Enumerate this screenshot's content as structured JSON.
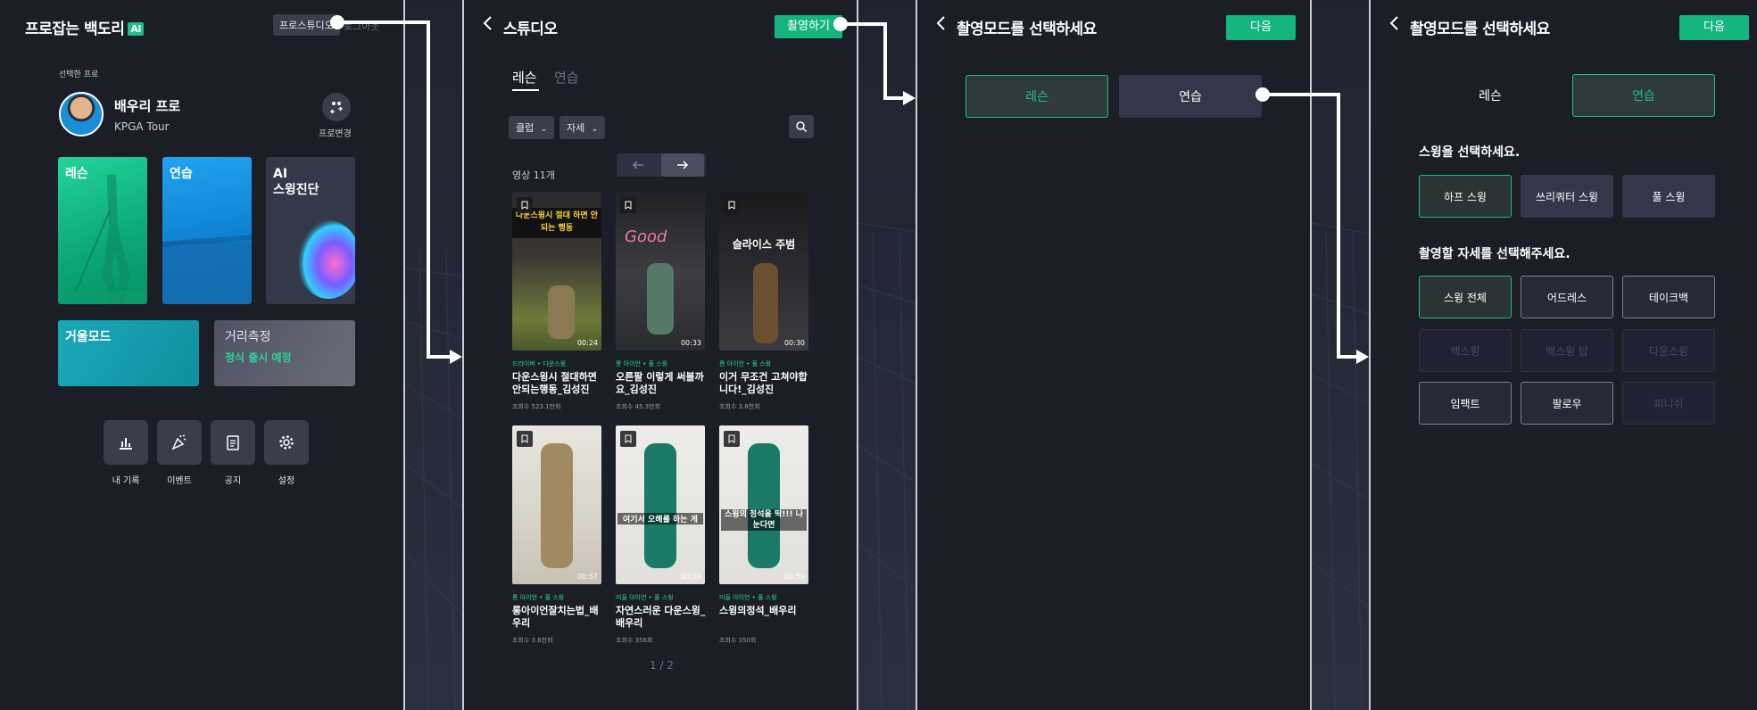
{
  "colors": {
    "accent": "#14b57f",
    "panel_bg": "#1b1d27",
    "button_bg": "#3a3d4a"
  },
  "screen1": {
    "brand": "프로잡는 백도리",
    "brand_badge": "AI",
    "pro_studio_button": "프로스튜디오",
    "logout": "로그아웃",
    "selected_label": "선택한 프로",
    "pro_name": "배우리 프로",
    "pro_tour": "KPGA Tour",
    "pro_change_label": "프로변경",
    "tiles": {
      "lesson": "레슨",
      "practice": "연습",
      "ai_swing": "AI\n스윙진단",
      "mirror": "거울모드",
      "distance": "거리측정",
      "distance_sub": "정식 출시 예정"
    },
    "menu": [
      {
        "label": "내 기록",
        "icon": "bar-chart-icon"
      },
      {
        "label": "이벤트",
        "icon": "party-popper-icon"
      },
      {
        "label": "공지",
        "icon": "clipboard-icon"
      },
      {
        "label": "설정",
        "icon": "gear-icon"
      }
    ]
  },
  "screen2": {
    "title": "스튜디오",
    "record_button": "촬영하기",
    "tabs": [
      "레슨",
      "연습"
    ],
    "filters": [
      "클럽",
      "자세"
    ],
    "count": "영상 11개",
    "videos": [
      {
        "tag": "드라이버 • 다운스윙",
        "title": "다운스윙시 절대하면 안되는행동_김성진",
        "views": "조회수 523.1만회",
        "duration": "00:24"
      },
      {
        "tag": "롱 아이언 • 풀 스윙",
        "title": "오른팔 이렇게 써볼까요_김성진",
        "views": "조회수 45.3만회",
        "duration": "00:33"
      },
      {
        "tag": "롱 아이언 • 풀 스윙",
        "title": "이거 무조건 고쳐야합니다!_김성진",
        "views": "조회수 3.8천회",
        "duration": "00:30"
      },
      {
        "tag": "롱 아이언 • 풀 스윙",
        "title": "롱아이언잘치는법_배우리",
        "views": "조회수 3.8천회",
        "duration": "00:57"
      },
      {
        "tag": "미들 아이언 • 풀 스윙",
        "title": "자연스러운 다운스윙_배우리",
        "views": "조회수 356회",
        "duration": "00:59"
      },
      {
        "tag": "미들 아이언 • 풀 스윙",
        "title": "스윙의정석_배우리",
        "views": "조회수 350회",
        "duration": "00:59"
      }
    ],
    "thumb_overlays": [
      "다운스윙시 절대 하면 안되는 행동",
      "Good",
      "슬라이스 주범",
      "",
      "여기서 오해를 하는 게",
      "스윙의 정석을 딱!!! 나눈다면"
    ],
    "page_indicator": "1 / 2"
  },
  "screen3": {
    "title": "촬영모드를 선택하세요",
    "next_button": "다음",
    "modes": [
      "레슨",
      "연습"
    ]
  },
  "screen4": {
    "title": "촬영모드를 선택하세요",
    "next_button": "다음",
    "modes": [
      "레슨",
      "연습"
    ],
    "swing_title": "스윙을 선택하세요.",
    "swings": [
      "하프 스윙",
      "쓰리쿼터 스윙",
      "풀 스윙"
    ],
    "pose_title": "촬영할 자세를 선택해주세요.",
    "poses": [
      "스윙 전체",
      "어드레스",
      "테이크백",
      "백스윙",
      "백스윙 탑",
      "다운스윙",
      "임팩트",
      "팔로우",
      "피니쉬"
    ]
  }
}
